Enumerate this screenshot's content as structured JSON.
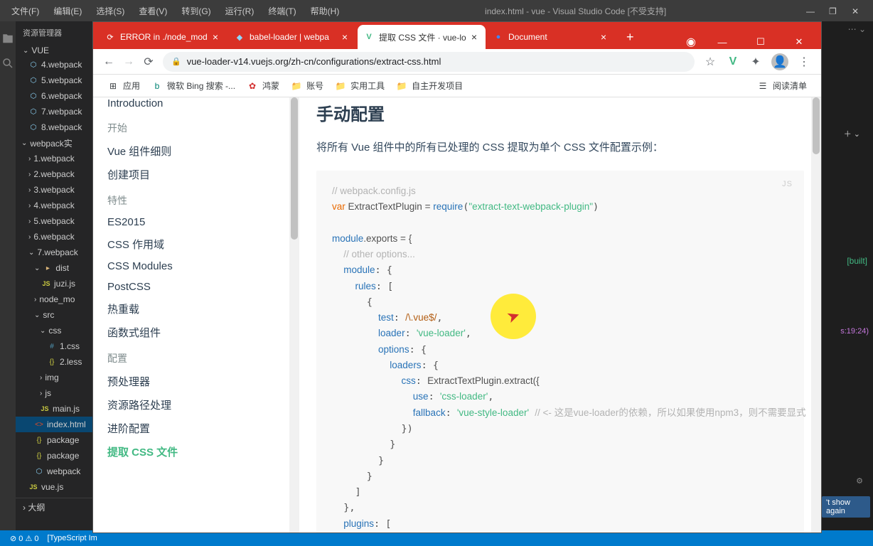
{
  "vscode": {
    "menus": [
      "文件(F)",
      "编辑(E)",
      "选择(S)",
      "查看(V)",
      "转到(G)",
      "运行(R)",
      "终端(T)",
      "帮助(H)"
    ],
    "title": "index.html - vue - Visual Studio Code [不受支持]",
    "sidebar_header": "资源管理器",
    "project_name": "VUE",
    "tree": {
      "w4": "4.webpack",
      "w5": "5.webpack",
      "w6": "6.webpack",
      "w7": "7.webpack",
      "w8": "8.webpack",
      "webpack_shi": "webpack实",
      "f1": "1.webpack",
      "f2": "2.webpack",
      "f3": "3.webpack",
      "f4": "4.webpack",
      "f5": "5.webpack",
      "f6": "6.webpack",
      "f7": "7.webpack",
      "dist": "dist",
      "juzi": "juzi.js",
      "node_m": "node_mo",
      "src": "src",
      "css": "css",
      "f1css": "1.css",
      "f2less": "2.less",
      "img": "img",
      "js": "js",
      "mainjs": "main.js",
      "indexhtml": "index.html",
      "package1": "package",
      "package2": "package",
      "webpackcfg": "webpack",
      "vuejs": "vue.js"
    },
    "outline": "大纲",
    "status": {
      "warnings": "0",
      "errors": "0",
      "typescript": "[TypeScript Im"
    }
  },
  "browser": {
    "tabs": [
      {
        "title": "ERROR in ./node_mod",
        "icon": "⟳"
      },
      {
        "title": "babel-loader | webpa",
        "icon": "◆"
      },
      {
        "title": "提取 CSS 文件 · vue-lo",
        "icon": "V"
      },
      {
        "title": "Document",
        "icon": "●"
      }
    ],
    "url": "vue-loader-v14.vuejs.org/zh-cn/configurations/extract-css.html",
    "bookmarks": {
      "apps": "应用",
      "bing": "微软 Bing 搜索 -...",
      "huawei": "鸿蒙",
      "acct": "账号",
      "tools": "实用工具",
      "dev": "自主开发项目",
      "reading": "阅读清单"
    }
  },
  "doc": {
    "nav": {
      "intro": "Introduction",
      "sec1": "开始",
      "s1a": "Vue 组件细则",
      "s1b": "创建项目",
      "sec2": "特性",
      "s2a": "ES2015",
      "s2b": "CSS 作用域",
      "s2c": "CSS Modules",
      "s2d": "PostCSS",
      "s2e": "热重载",
      "s2f": "函数式组件",
      "sec3": "配置",
      "s3a": "预处理器",
      "s3b": "资源路径处理",
      "s3c": "进阶配置",
      "s3d": "提取 CSS 文件"
    },
    "heading": "手动配置",
    "paragraph": "将所有 Vue 组件中的所有已处理的 CSS 提取为单个 CSS 文件配置示例：",
    "code": {
      "lang": "JS",
      "c1": "// webpack.config.js",
      "kw_var": "var",
      "v_name": " ExtractTextPlugin = ",
      "kw_require": "require",
      "str_pkg": "\"extract-text-webpack-plugin\"",
      "v_module": "module",
      "v_exports": ".exports = {",
      "c2": "// other options...",
      "a_module": "module",
      "a_rules": "rules",
      "a_test": "test",
      "rx": "/\\.vue$/",
      "a_loader": "loader",
      "s_vloader": "'vue-loader'",
      "a_options": "options",
      "a_loaders": "loaders",
      "a_css": "css",
      "fn_extract": "ExtractTextPlugin.extract({",
      "a_use": "use",
      "s_cssloader": "'css-loader'",
      "a_fallback": "fallback",
      "s_vsl": "'vue-style-loader'",
      "c3": "// <- 这是vue-loader的依赖，所以如果使用npm3，则不需要显式",
      "a_plugins": "plugins"
    }
  },
  "right": {
    "built": "[built]",
    "time": "s:19:24)",
    "notice": "'t show again",
    "plus": "+"
  }
}
